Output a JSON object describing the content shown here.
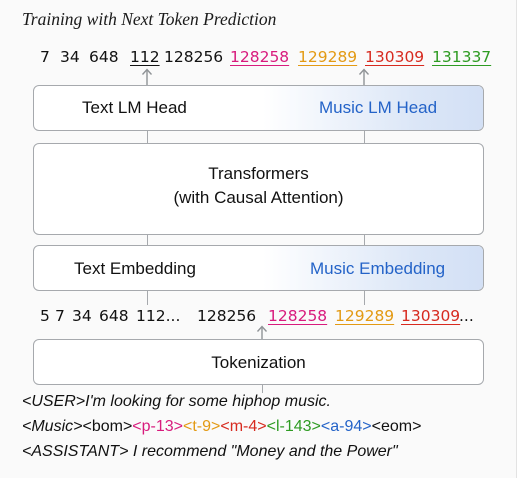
{
  "heading": "Training with Next Token Prediction",
  "top_tokens": [
    {
      "text": "7",
      "color": "#111111",
      "underline": false
    },
    {
      "text": "34",
      "color": "#111111",
      "underline": false
    },
    {
      "text": "648",
      "color": "#111111",
      "underline": false
    },
    {
      "text": "112",
      "color": "#111111",
      "underline": true
    },
    {
      "text": "128256",
      "color": "#111111",
      "underline": false
    },
    {
      "text": "128258",
      "color": "#d81b7d",
      "underline": true
    },
    {
      "text": "129289",
      "color": "#e39a14",
      "underline": true
    },
    {
      "text": "130309",
      "color": "#d72a1f",
      "underline": true
    },
    {
      "text": "131337",
      "color": "#2e9b22",
      "underline": true
    }
  ],
  "lm_head": {
    "text_label": "Text LM Head",
    "music_label": "Music LM Head"
  },
  "transformer": {
    "line1": "Transformers",
    "line2": "(with Causal Attention)"
  },
  "embedding": {
    "text_label": "Text Embedding",
    "music_label": "Music Embedding"
  },
  "input_tokens": [
    {
      "text": "5",
      "color": "#111111",
      "underline": false
    },
    {
      "text": "7",
      "color": "#111111",
      "underline": false
    },
    {
      "text": "34",
      "color": "#111111",
      "underline": false
    },
    {
      "text": "648",
      "color": "#111111",
      "underline": false
    },
    {
      "text": "112...",
      "color": "#111111",
      "underline": false
    },
    {
      "text": "128256",
      "color": "#111111",
      "underline": false
    },
    {
      "text": "128258",
      "color": "#d81b7d",
      "underline": true
    },
    {
      "text": "129289",
      "color": "#e39a14",
      "underline": true
    },
    {
      "text": "130309",
      "color": "#d72a1f",
      "underline": true
    },
    {
      "text": "...",
      "color": "#111111",
      "underline": false
    }
  ],
  "tokenization": "Tokenization",
  "dialog": {
    "user_tag": "<USER>",
    "user_text": "I'm looking for some hiphop music.",
    "music_tag": "<Music>",
    "bom": "<bom>",
    "music_attrs": [
      {
        "text": "<p-13>",
        "color": "#d81b7d"
      },
      {
        "text": "<t-9>",
        "color": "#e39a14"
      },
      {
        "text": "<m-4>",
        "color": "#d72a1f"
      },
      {
        "text": "<l-143>",
        "color": "#2e9b22"
      },
      {
        "text": "<a-94>",
        "color": "#2463c8"
      }
    ],
    "eom": "<eom>",
    "assistant_tag": "<ASSISTANT>",
    "assistant_text": "I recommend \"Money and the Power\""
  },
  "colors": {
    "music_blue": "#2463c8",
    "border_gray": "#a6a9ad",
    "gradient_blue": "#d3e0f5"
  }
}
